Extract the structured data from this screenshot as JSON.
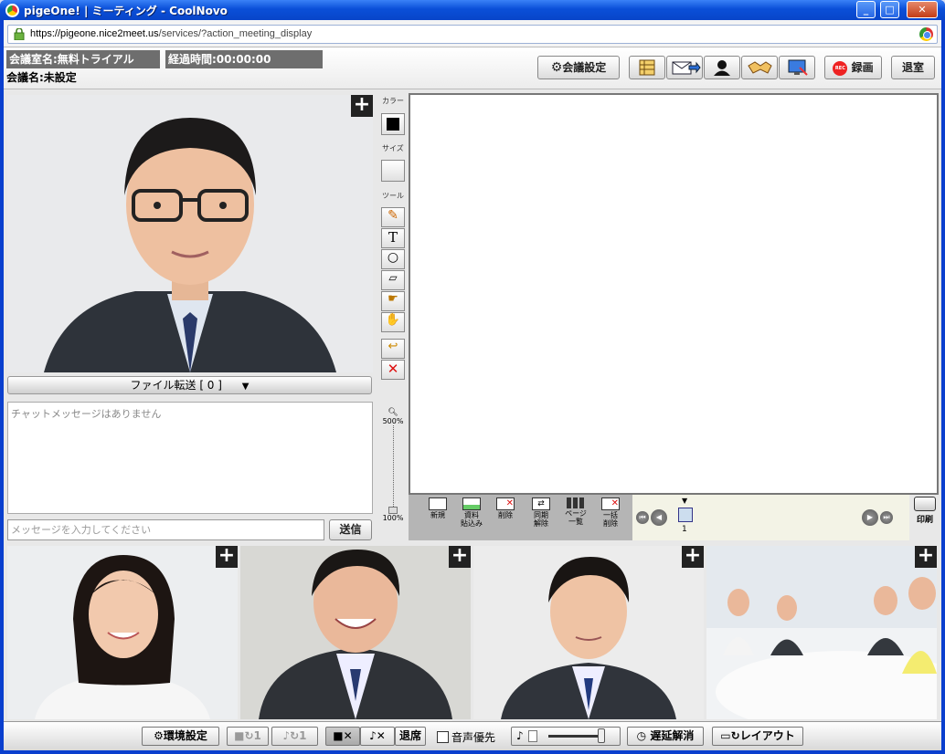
{
  "window": {
    "title": "pigeOne! | ミーティング - CoolNovo",
    "url_host": "https://pigeone.nice2meet.us",
    "url_path": "/services/?action_meeting_display",
    "buttons": [
      "minimize",
      "maximize",
      "close"
    ]
  },
  "header": {
    "room_name": "会議室名:無料トライアル",
    "elapsed": "経過時間:00:00:00",
    "meeting_name": "会議名:未設定",
    "settings_label": "会議設定",
    "record_label": "録画",
    "exit_label": "退室",
    "icon_buttons": [
      "table-icon",
      "mail-invite-icon",
      "user-icon",
      "handshake-icon",
      "screen-share-icon"
    ]
  },
  "tools": {
    "color_label": "カラー",
    "size_label": "サイズ",
    "tool_label": "ツール",
    "color": "#000000",
    "zoom_max": "500%",
    "zoom_min": "100%"
  },
  "chat": {
    "file_transfer": "ファイル転送 [ 0 ]",
    "empty_message": "チャットメッセージはありません",
    "input_placeholder": "メッセージを入力してください",
    "send_label": "送信"
  },
  "board_panel": {
    "buttons": [
      {
        "label1": "新規",
        "label2": ""
      },
      {
        "label1": "資料",
        "label2": "貼込み"
      },
      {
        "label1": "削除",
        "label2": ""
      },
      {
        "label1": "同期",
        "label2": "解除"
      },
      {
        "label1": "ページ",
        "label2": "一覧"
      },
      {
        "label1": "一括",
        "label2": "削除"
      }
    ],
    "current_page": "1",
    "print_label": "印刷"
  },
  "bottom": {
    "env_settings": "環境設定",
    "video_count": "1",
    "audio_count": "1",
    "leave_seat": "退席",
    "audio_priority": "音声優先",
    "delay_release": "遅延解消",
    "layout": "レイアウト"
  }
}
